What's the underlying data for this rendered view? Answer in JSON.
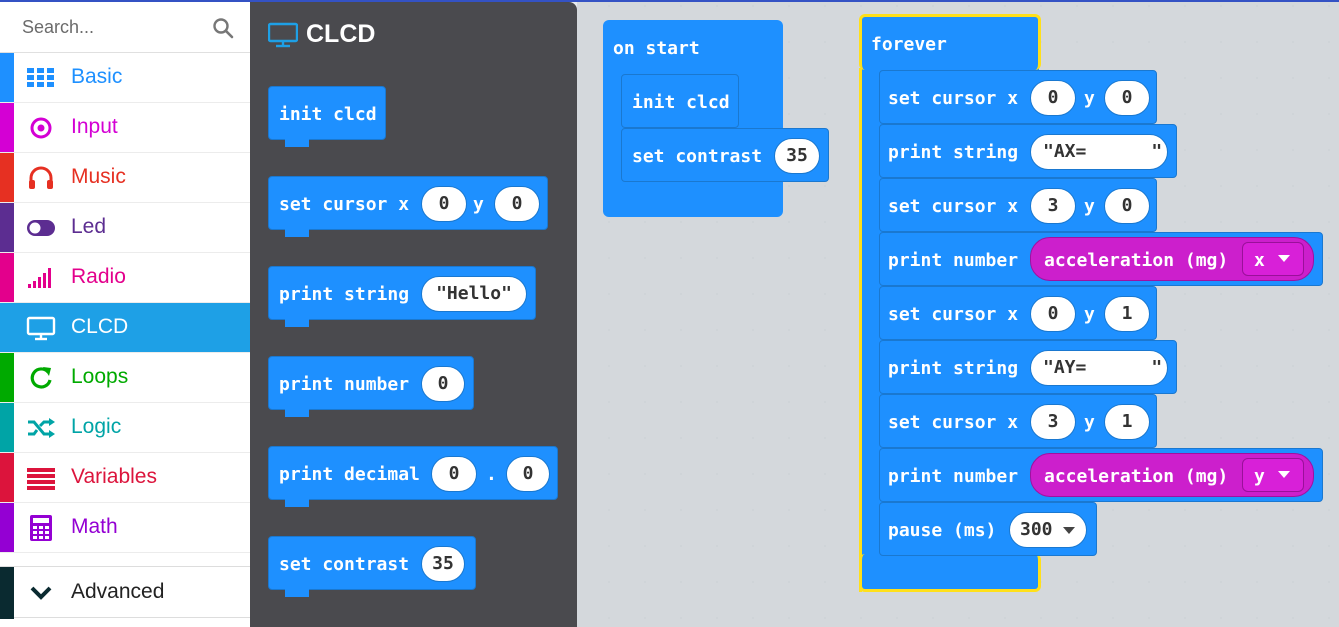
{
  "sidebar": {
    "search_placeholder": "Search...",
    "categories": [
      {
        "label": "Basic",
        "color": "#1e90ff"
      },
      {
        "label": "Input",
        "color": "#d400d4"
      },
      {
        "label": "Music",
        "color": "#e63022"
      },
      {
        "label": "Led",
        "color": "#5c2d91"
      },
      {
        "label": "Radio",
        "color": "#e3008c"
      },
      {
        "label": "CLCD",
        "color": "#1ea0e6"
      },
      {
        "label": "Loops",
        "color": "#00aa00"
      },
      {
        "label": "Logic",
        "color": "#00a4a6"
      },
      {
        "label": "Variables",
        "color": "#dc143c"
      },
      {
        "label": "Math",
        "color": "#9400d3"
      }
    ],
    "advanced_label": "Advanced",
    "selected": "CLCD"
  },
  "flyout": {
    "title": "CLCD",
    "blocks": {
      "init": "init clcd",
      "set_cursor": "set cursor x",
      "set_cursor_y": "y",
      "set_cursor_x_val": "0",
      "set_cursor_y_val": "0",
      "print_string": "print string",
      "print_string_val": "\"Hello\"",
      "print_number": "print number",
      "print_number_val": "0",
      "print_decimal": "print decimal",
      "print_decimal_a": "0",
      "print_decimal_dot": ".",
      "print_decimal_b": "0",
      "set_contrast": "set contrast",
      "set_contrast_val": "35"
    }
  },
  "workspace": {
    "on_start": {
      "label": "on start",
      "init": "init clcd",
      "set_contrast": "set contrast",
      "contrast_val": "35"
    },
    "forever": {
      "label": "forever",
      "rows": [
        {
          "kind": "cursor",
          "text": "set cursor x",
          "x": "0",
          "y_label": "y",
          "y": "0"
        },
        {
          "kind": "string",
          "text": "print string",
          "value": "\"AX=      \""
        },
        {
          "kind": "cursor",
          "text": "set cursor x",
          "x": "3",
          "y_label": "y",
          "y": "0"
        },
        {
          "kind": "number",
          "text": "print number",
          "sensor": "acceleration (mg)",
          "axis": "x"
        },
        {
          "kind": "cursor",
          "text": "set cursor x",
          "x": "0",
          "y_label": "y",
          "y": "1"
        },
        {
          "kind": "string",
          "text": "print string",
          "value": "\"AY=      \""
        },
        {
          "kind": "cursor",
          "text": "set cursor x",
          "x": "3",
          "y_label": "y",
          "y": "1"
        },
        {
          "kind": "number",
          "text": "print number",
          "sensor": "acceleration (mg)",
          "axis": "y"
        },
        {
          "kind": "pause",
          "text": "pause (ms)",
          "value": "300"
        }
      ]
    }
  }
}
